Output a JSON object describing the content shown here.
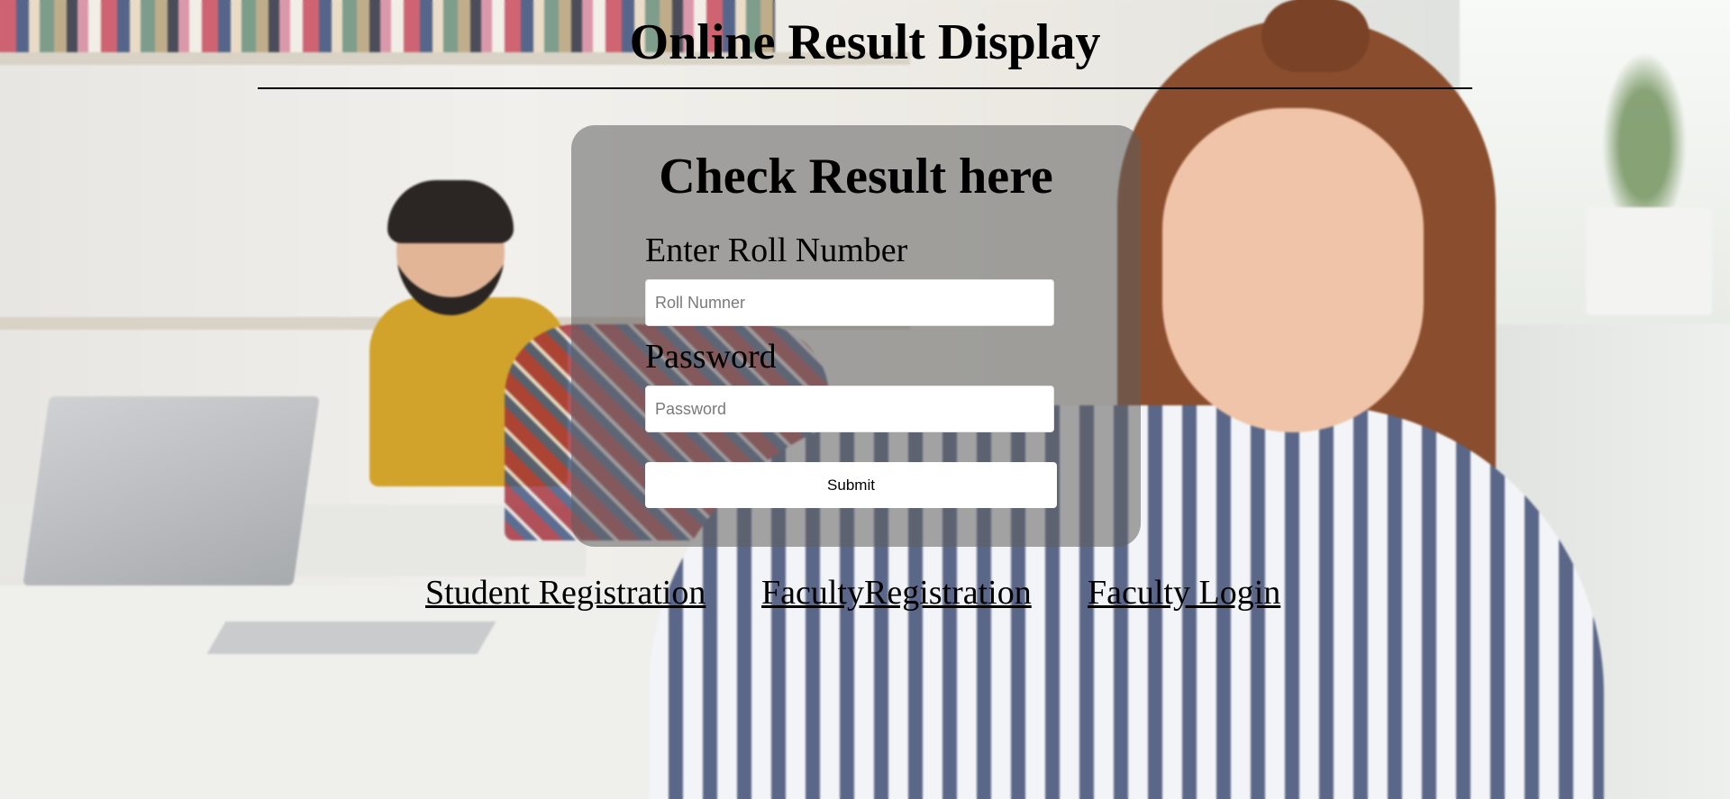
{
  "page": {
    "title": "Online Result Display"
  },
  "form": {
    "heading": "Check Result here",
    "roll_label": "Enter Roll Number",
    "roll_placeholder": "Roll Numner",
    "roll_value": "",
    "password_label": "Password",
    "password_placeholder": "Password",
    "password_value": "",
    "submit_label": "Submit"
  },
  "links": {
    "student_registration": "Student Registration",
    "faculty_registration": "FacultyRegistration",
    "faculty_login": "Faculty Login"
  },
  "colors": {
    "text": "#000000",
    "card_overlay": "rgba(95,95,95,0.55)",
    "input_bg": "#ffffff"
  }
}
